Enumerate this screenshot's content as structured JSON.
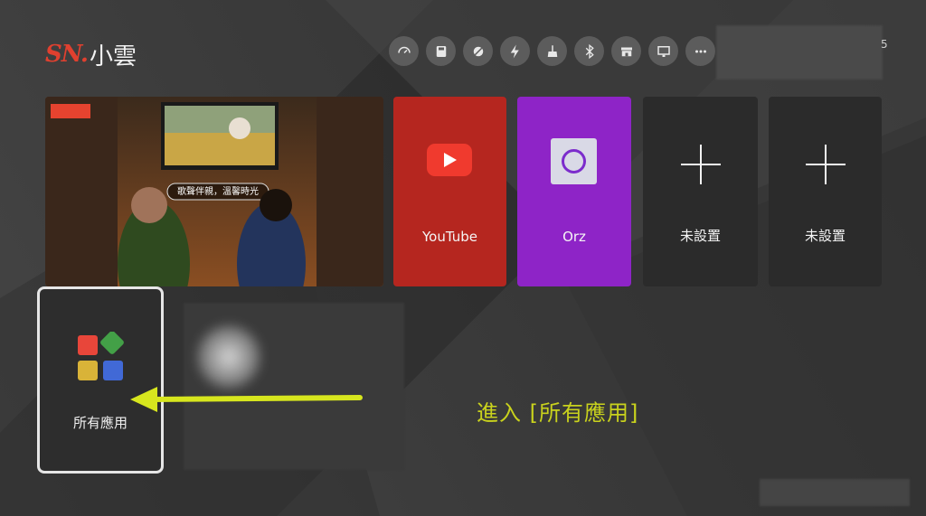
{
  "logo": {
    "brand": "SN.",
    "name": "小雲"
  },
  "toolbar": {
    "icons": [
      "speedometer-icon",
      "storage-icon",
      "clean-icon",
      "boost-icon",
      "broom-icon",
      "bluetooth-icon",
      "store-icon",
      "screen-icon",
      "more-icon"
    ]
  },
  "corner_text": "5",
  "featured": {
    "caption": "歌聲伴親，溫馨時光"
  },
  "apps": [
    {
      "label": "YouTube"
    },
    {
      "label": "Orz"
    },
    {
      "label": "未設置"
    },
    {
      "label": "未設置"
    }
  ],
  "all_apps": {
    "label": "所有應用"
  },
  "instruction": "進入 [所有應用]",
  "colors": {
    "accent_logo": "#e0402f",
    "arrow": "#d7e61e",
    "youtube": "#b5261f",
    "orz": "#8e24c7"
  }
}
